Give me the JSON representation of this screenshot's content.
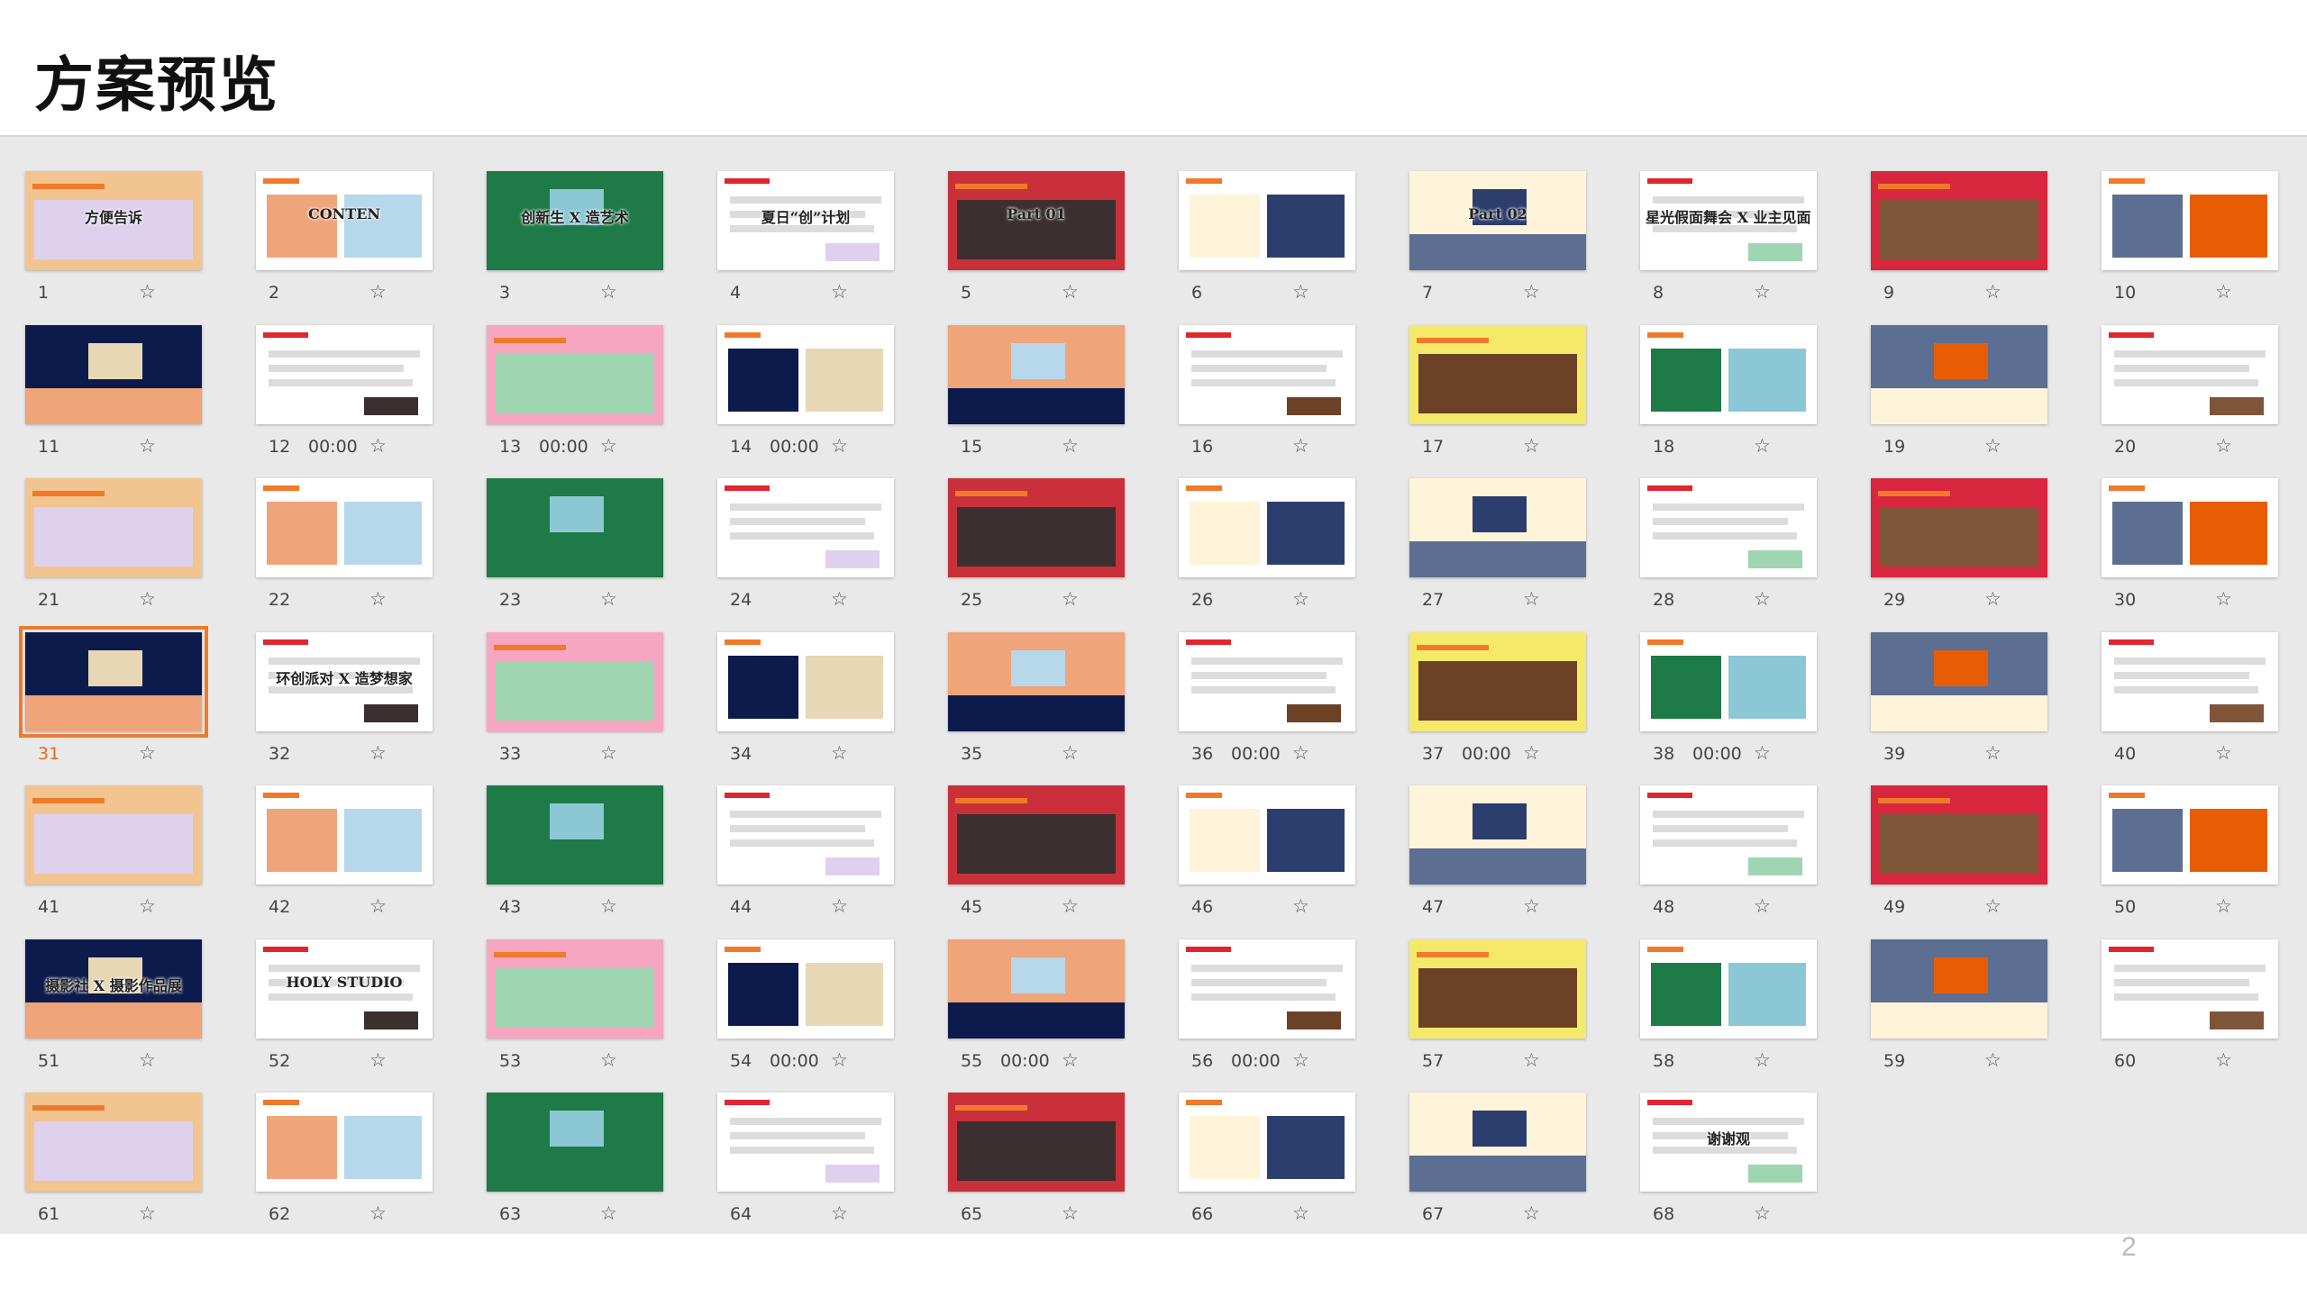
{
  "header": {
    "title": "方案预览"
  },
  "footer": {
    "page_number": "2"
  },
  "selected_slide": 31,
  "thumb_colors": [
    "#f2c48f",
    "#f0a47a",
    "#8cc7d6",
    "#ded1ee",
    "#c9303a",
    "#fff4d9",
    "#2c3e6e",
    "#9fd6b1",
    "#d7263d",
    "#5c6e91",
    "#e8d7b5",
    "#3b2f2f",
    "#f7a6c2",
    "#0d1b4c",
    "#b7d7ea",
    "#6b4226",
    "#f5e96b",
    "#1e7a46",
    "#e85d04",
    "#7f5539"
  ],
  "slides": [
    {
      "number": "1",
      "duration": "",
      "thumb_text": "方便告诉"
    },
    {
      "number": "2",
      "duration": "",
      "thumb_text": "CONTEN"
    },
    {
      "number": "3",
      "duration": "",
      "thumb_text": "创新生 X 造艺术"
    },
    {
      "number": "4",
      "duration": "",
      "thumb_text": "夏日“创”计划"
    },
    {
      "number": "5",
      "duration": "",
      "thumb_text": "Part 01"
    },
    {
      "number": "6",
      "duration": "",
      "thumb_text": ""
    },
    {
      "number": "7",
      "duration": "",
      "thumb_text": "Part 02"
    },
    {
      "number": "8",
      "duration": "",
      "thumb_text": "星光假面舞会 X 业主见面日"
    },
    {
      "number": "9",
      "duration": "",
      "thumb_text": ""
    },
    {
      "number": "10",
      "duration": "",
      "thumb_text": ""
    },
    {
      "number": "11",
      "duration": "",
      "thumb_text": ""
    },
    {
      "number": "12",
      "duration": "00:00",
      "thumb_text": ""
    },
    {
      "number": "13",
      "duration": "00:00",
      "thumb_text": ""
    },
    {
      "number": "14",
      "duration": "00:00",
      "thumb_text": ""
    },
    {
      "number": "15",
      "duration": "",
      "thumb_text": ""
    },
    {
      "number": "16",
      "duration": "",
      "thumb_text": ""
    },
    {
      "number": "17",
      "duration": "",
      "thumb_text": ""
    },
    {
      "number": "18",
      "duration": "",
      "thumb_text": ""
    },
    {
      "number": "19",
      "duration": "",
      "thumb_text": ""
    },
    {
      "number": "20",
      "duration": "",
      "thumb_text": ""
    },
    {
      "number": "21",
      "duration": "",
      "thumb_text": ""
    },
    {
      "number": "22",
      "duration": "",
      "thumb_text": ""
    },
    {
      "number": "23",
      "duration": "",
      "thumb_text": ""
    },
    {
      "number": "24",
      "duration": "",
      "thumb_text": ""
    },
    {
      "number": "25",
      "duration": "",
      "thumb_text": ""
    },
    {
      "number": "26",
      "duration": "",
      "thumb_text": ""
    },
    {
      "number": "27",
      "duration": "",
      "thumb_text": ""
    },
    {
      "number": "28",
      "duration": "",
      "thumb_text": ""
    },
    {
      "number": "29",
      "duration": "",
      "thumb_text": ""
    },
    {
      "number": "30",
      "duration": "",
      "thumb_text": ""
    },
    {
      "number": "31",
      "duration": "",
      "thumb_text": ""
    },
    {
      "number": "32",
      "duration": "",
      "thumb_text": "环创派对 X 造梦想家"
    },
    {
      "number": "33",
      "duration": "",
      "thumb_text": ""
    },
    {
      "number": "34",
      "duration": "",
      "thumb_text": ""
    },
    {
      "number": "35",
      "duration": "",
      "thumb_text": ""
    },
    {
      "number": "36",
      "duration": "00:00",
      "thumb_text": ""
    },
    {
      "number": "37",
      "duration": "00:00",
      "thumb_text": ""
    },
    {
      "number": "38",
      "duration": "00:00",
      "thumb_text": ""
    },
    {
      "number": "39",
      "duration": "",
      "thumb_text": ""
    },
    {
      "number": "40",
      "duration": "",
      "thumb_text": ""
    },
    {
      "number": "41",
      "duration": "",
      "thumb_text": ""
    },
    {
      "number": "42",
      "duration": "",
      "thumb_text": ""
    },
    {
      "number": "43",
      "duration": "",
      "thumb_text": ""
    },
    {
      "number": "44",
      "duration": "",
      "thumb_text": ""
    },
    {
      "number": "45",
      "duration": "",
      "thumb_text": ""
    },
    {
      "number": "46",
      "duration": "",
      "thumb_text": ""
    },
    {
      "number": "47",
      "duration": "",
      "thumb_text": ""
    },
    {
      "number": "48",
      "duration": "",
      "thumb_text": ""
    },
    {
      "number": "49",
      "duration": "",
      "thumb_text": ""
    },
    {
      "number": "50",
      "duration": "",
      "thumb_text": ""
    },
    {
      "number": "51",
      "duration": "",
      "thumb_text": "摄影社 X 摄影作品展"
    },
    {
      "number": "52",
      "duration": "",
      "thumb_text": "HOLY STUDIO"
    },
    {
      "number": "53",
      "duration": "",
      "thumb_text": ""
    },
    {
      "number": "54",
      "duration": "00:00",
      "thumb_text": ""
    },
    {
      "number": "55",
      "duration": "00:00",
      "thumb_text": ""
    },
    {
      "number": "56",
      "duration": "00:00",
      "thumb_text": ""
    },
    {
      "number": "57",
      "duration": "",
      "thumb_text": ""
    },
    {
      "number": "58",
      "duration": "",
      "thumb_text": ""
    },
    {
      "number": "59",
      "duration": "",
      "thumb_text": ""
    },
    {
      "number": "60",
      "duration": "",
      "thumb_text": ""
    },
    {
      "number": "61",
      "duration": "",
      "thumb_text": ""
    },
    {
      "number": "62",
      "duration": "",
      "thumb_text": ""
    },
    {
      "number": "63",
      "duration": "",
      "thumb_text": ""
    },
    {
      "number": "64",
      "duration": "",
      "thumb_text": ""
    },
    {
      "number": "65",
      "duration": "",
      "thumb_text": ""
    },
    {
      "number": "66",
      "duration": "",
      "thumb_text": ""
    },
    {
      "number": "67",
      "duration": "",
      "thumb_text": ""
    },
    {
      "number": "68",
      "duration": "",
      "thumb_text": "谢谢观"
    }
  ]
}
